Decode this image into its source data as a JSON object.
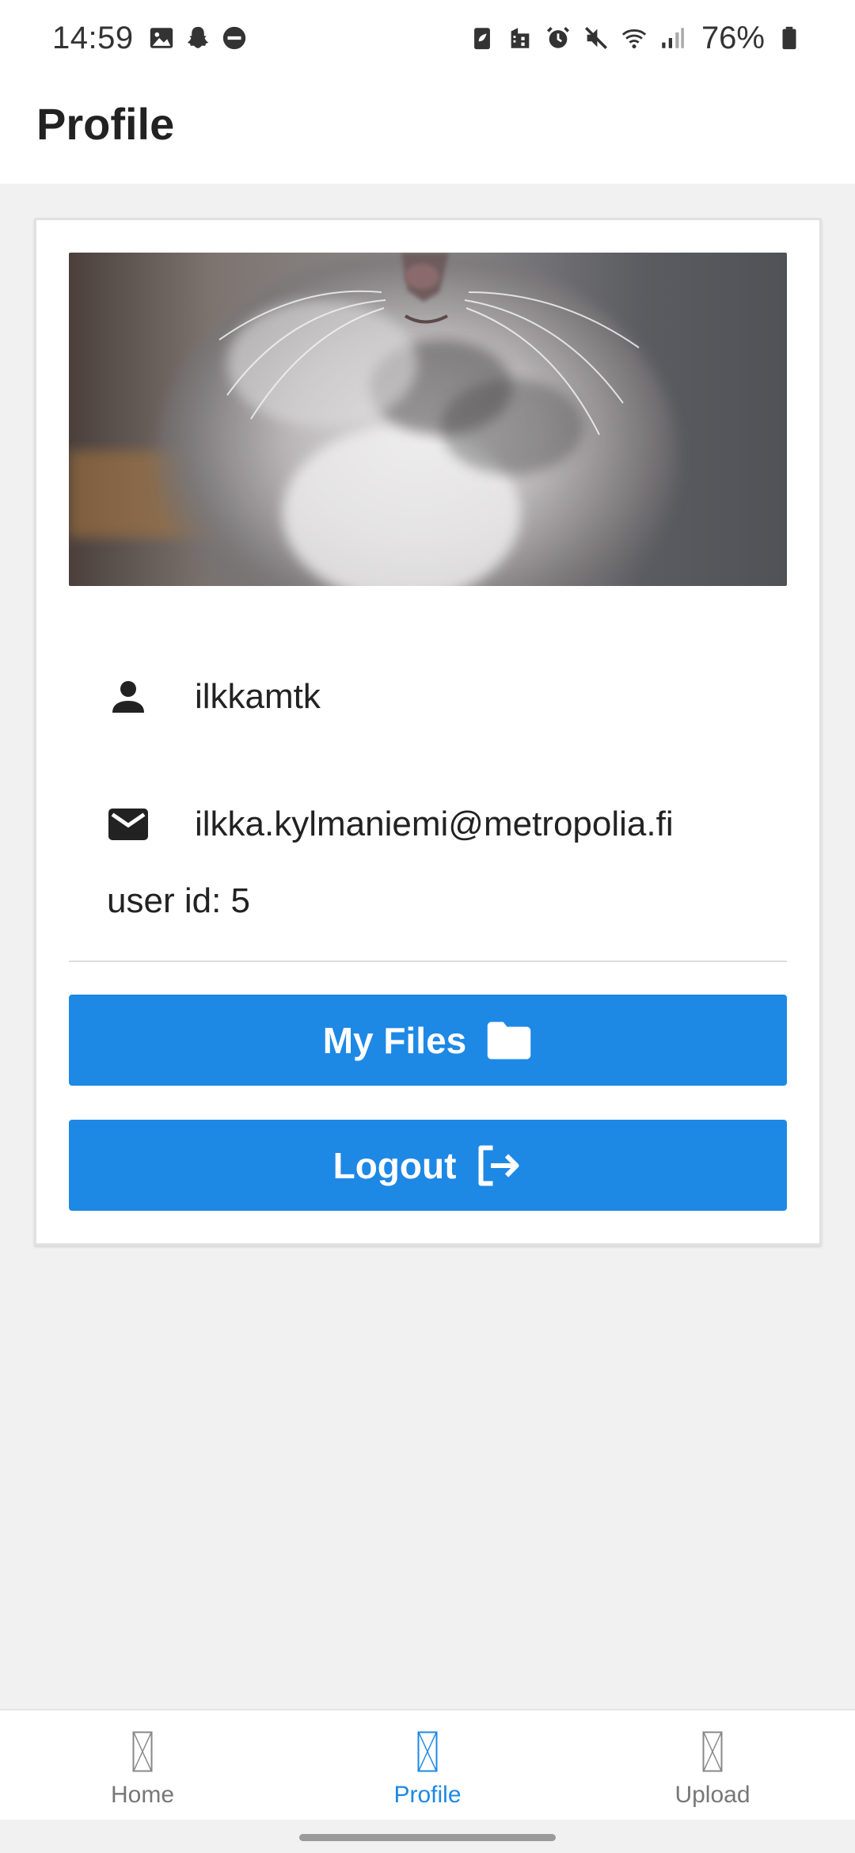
{
  "status_bar": {
    "time": "14:59",
    "battery": "76%",
    "left_icons": [
      "gallery-icon",
      "snapchat-icon",
      "do-not-disturb-icon"
    ],
    "right_icons": [
      "battery-saver-icon",
      "work-profile-icon",
      "alarm-icon",
      "mute-icon",
      "wifi-icon",
      "signal-icon",
      "battery-icon"
    ]
  },
  "header": {
    "title": "Profile"
  },
  "profile": {
    "username": "ilkkamtk",
    "email": "ilkka.kylmaniemi@metropolia.fi",
    "user_id_label": "user id: 5"
  },
  "buttons": {
    "my_files": "My Files",
    "logout": "Logout"
  },
  "nav": {
    "items": [
      {
        "label": "Home",
        "active": false
      },
      {
        "label": "Profile",
        "active": true
      },
      {
        "label": "Upload",
        "active": false
      }
    ]
  },
  "colors": {
    "accent": "#1e88e5",
    "inactive": "#777777",
    "background": "#f1f1f1"
  }
}
